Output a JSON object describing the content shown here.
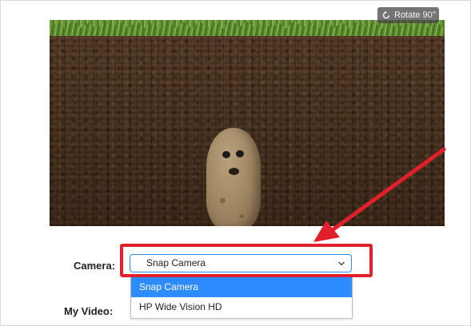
{
  "preview": {
    "rotate_label": "Rotate 90°",
    "rotate_icon": "rotate-icon"
  },
  "camera": {
    "label": "Camera:",
    "selected": "Snap Camera",
    "options": [
      "Snap Camera",
      "HP Wide Vision HD"
    ]
  },
  "my_video": {
    "label": "My Video:"
  },
  "colors": {
    "accent": "#2d8cff",
    "annotation_red": "#e0202a"
  }
}
